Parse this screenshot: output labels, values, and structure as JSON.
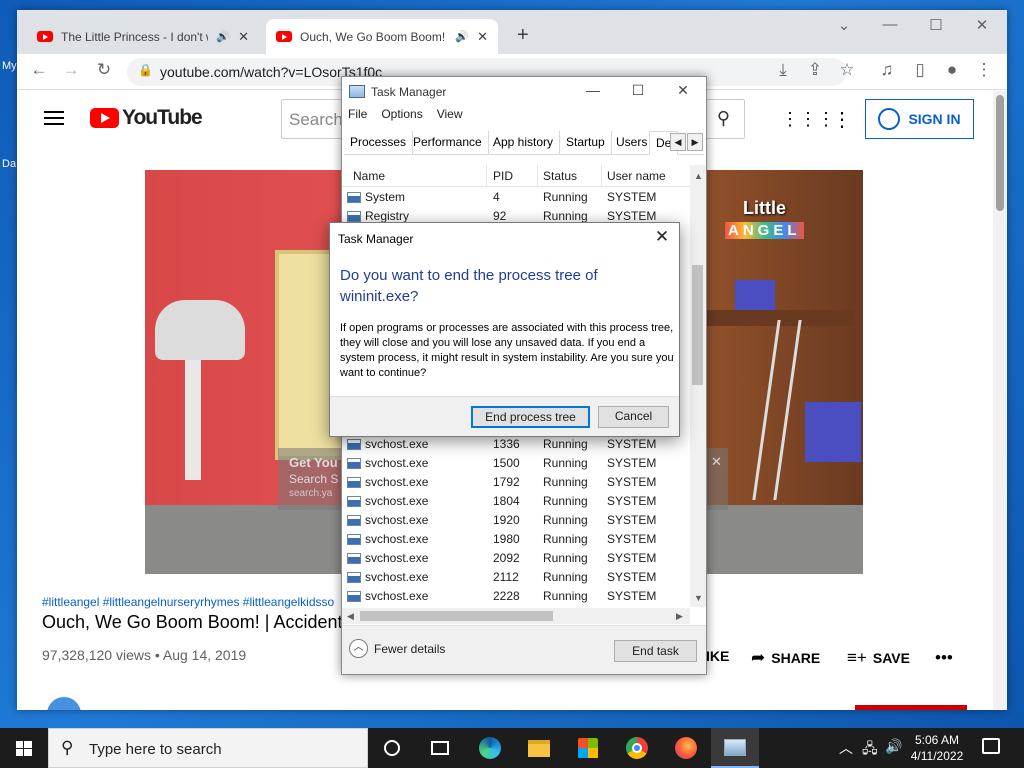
{
  "desktop": {
    "label1": "My",
    "label2": "Da"
  },
  "browser": {
    "tabs": [
      {
        "title": "The Little Princess - I don't w"
      },
      {
        "title": "Ouch, We Go Boom Boom! |"
      }
    ],
    "url": "youtube.com/watch?v=LOsorTs1f0c"
  },
  "youtube": {
    "logo_text": "YouTube",
    "search_placeholder": "Search",
    "sign_in": "SIGN IN",
    "player": {
      "brand_top": "Little",
      "brand_bottom": "ANGEL",
      "ad_line1": "Get You",
      "ad_line2": "Search S",
      "ad_line3": "search.ya"
    },
    "hashtags": "#littleangel #littleangelnurseryrhymes #littleangelkidsso",
    "title": "Ouch, We Go Boom Boom! | Accidents",
    "views": "97,328,120 views • Aug 14, 2019",
    "actions": {
      "like": "IKE",
      "share": "SHARE",
      "save": "SAVE"
    }
  },
  "taskmanager": {
    "title": "Task Manager",
    "menu": [
      "File",
      "Options",
      "View"
    ],
    "tabs": [
      "Processes",
      "Performance",
      "App history",
      "Startup",
      "Users",
      "De"
    ],
    "columns": [
      "Name",
      "PID",
      "Status",
      "User name"
    ],
    "rows_top": [
      {
        "name": "System",
        "pid": "4",
        "status": "Running",
        "user": "SYSTEM"
      },
      {
        "name": "Registry",
        "pid": "92",
        "status": "Running",
        "user": "SYSTEM"
      }
    ],
    "rows_bottom": [
      {
        "name": "svchost.exe",
        "pid": "1336",
        "status": "Running",
        "user": "SYSTEM"
      },
      {
        "name": "svchost.exe",
        "pid": "1500",
        "status": "Running",
        "user": "SYSTEM"
      },
      {
        "name": "svchost.exe",
        "pid": "1792",
        "status": "Running",
        "user": "SYSTEM"
      },
      {
        "name": "svchost.exe",
        "pid": "1804",
        "status": "Running",
        "user": "SYSTEM"
      },
      {
        "name": "svchost.exe",
        "pid": "1920",
        "status": "Running",
        "user": "SYSTEM"
      },
      {
        "name": "svchost.exe",
        "pid": "1980",
        "status": "Running",
        "user": "SYSTEM"
      },
      {
        "name": "svchost.exe",
        "pid": "2092",
        "status": "Running",
        "user": "SYSTEM"
      },
      {
        "name": "svchost.exe",
        "pid": "2112",
        "status": "Running",
        "user": "SYSTEM"
      },
      {
        "name": "svchost.exe",
        "pid": "2228",
        "status": "Running",
        "user": "SYSTEM"
      }
    ],
    "fewer_details": "Fewer details",
    "end_task": "End task"
  },
  "dialog": {
    "title": "Task Manager",
    "question": "Do you want to end the process tree of wininit.exe?",
    "body": "If open programs or processes are associated with this process tree, they will close and you will lose any unsaved data. If you end a system process, it might result in system instability. Are you sure you want to continue?",
    "confirm": "End process tree",
    "cancel": "Cancel"
  },
  "taskbar": {
    "search_placeholder": "Type here to search",
    "time": "5:06 AM",
    "date": "4/11/2022"
  },
  "icons": {
    "back": "arrow-left",
    "forward": "arrow-right",
    "reload": "reload",
    "lock": "lock",
    "install": "install",
    "share": "share",
    "star": "star",
    "media": "media-control",
    "sidepanel": "side-panel",
    "profile": "profile",
    "menu": "kebab"
  },
  "colors": {
    "youtube_red": "#ff0000",
    "link_blue": "#065fd4",
    "dialog_heading": "#1e3d9a",
    "taskbar": "#1c1c1c"
  }
}
